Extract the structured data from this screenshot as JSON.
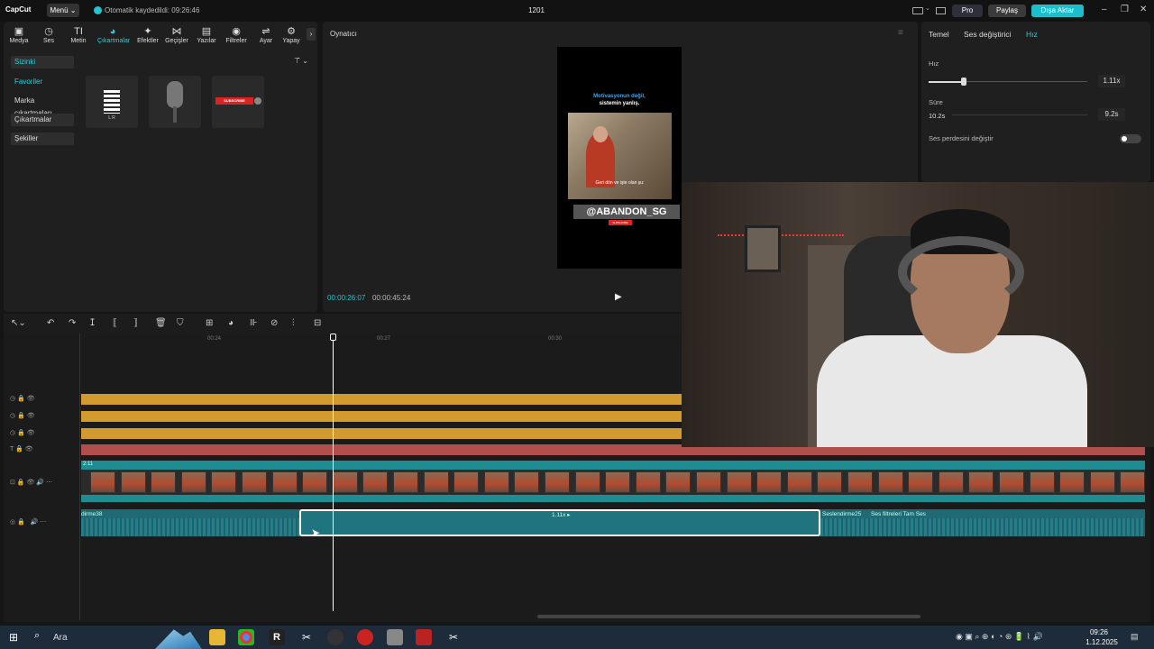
{
  "app": {
    "logo": "CapCut",
    "menu": "Menü ⌄",
    "autosave": "Otomatik kaydedildi: 09:26:46",
    "project_title": "1201"
  },
  "header": {
    "pro": "Pro",
    "share": "Paylaş",
    "export": "Dışa Aktar"
  },
  "tool_tabs": [
    {
      "icon": "▣",
      "label": "Medya"
    },
    {
      "icon": "◷",
      "label": "Ses"
    },
    {
      "icon": "TI",
      "label": "Metin"
    },
    {
      "icon": "◕",
      "label": "Çıkartmalar"
    },
    {
      "icon": "✦",
      "label": "Efektler"
    },
    {
      "icon": "⋈",
      "label": "Geçişler"
    },
    {
      "icon": "▤",
      "label": "Yazılar"
    },
    {
      "icon": "◉",
      "label": "Filtreler"
    },
    {
      "icon": "⇌",
      "label": "Ayar"
    },
    {
      "icon": "⚙",
      "label": "Yapay"
    }
  ],
  "sidebar": {
    "yours": "Sizinki",
    "items": [
      "Favoriler",
      "Marka çıkartmaları",
      "Çıkartmalar",
      "Şekiller"
    ]
  },
  "stickers": {
    "subscribe": "SUBSCRIBE",
    "meter_label": "L R"
  },
  "player": {
    "title": "Oynatıcı",
    "caption_blue": "Motivasyonun değil,",
    "caption_white": "sistemin yanlış.",
    "sub_caption": "Geri dön ve işte olan şu:",
    "handle": "@ABANDON_SG",
    "subscribe": "SUBSCRIBE",
    "time_current": "00:00:26:07",
    "time_total": "00:00:45:24"
  },
  "properties": {
    "tabs": [
      "Temel",
      "Ses değiştirici",
      "Hız"
    ],
    "speed_label": "Hız",
    "speed_value": "1.11x",
    "speed_fraction": 0.2,
    "duration_label": "Süre",
    "duration_from": "10.2s",
    "duration_value": "9.2s",
    "pitch_label": "Ses perdesini değiştir",
    "pitch_on": false
  },
  "timeline": {
    "ticks": [
      "00:24",
      "00:27",
      "00:30"
    ],
    "video_label": "2:11",
    "audio_left": "dirme38",
    "audio_speed": "1.11x ▸",
    "audio_right": "Seslendirme25",
    "audio_right2": "Ses filtreleri Tam Ses"
  },
  "taskbar": {
    "search": "Ara",
    "time": "09:26",
    "date": "1.12.2025"
  },
  "colors": {
    "accent": "#1dbecb",
    "orange_track": "#d39a2f",
    "audio_track": "#1f6a74"
  }
}
